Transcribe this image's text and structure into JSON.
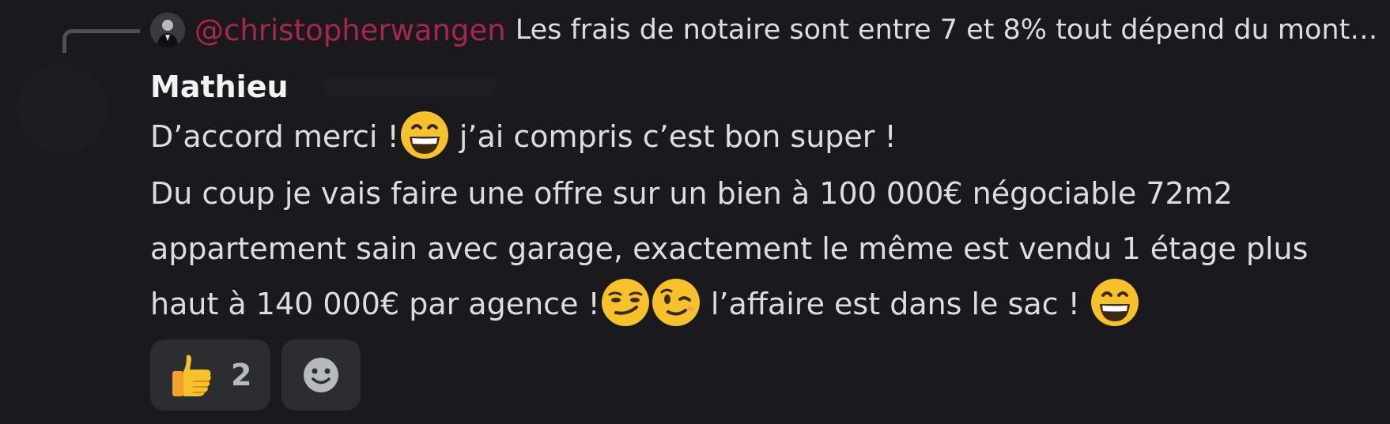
{
  "reply": {
    "author": "@christopherwangen",
    "text": "Les frais de notaire sont entre 7 et 8% tout dépend du monta..."
  },
  "message": {
    "author": "Mathieu",
    "line1_part1": "D’accord merci !",
    "line1_emoji": "grinning-face-icon",
    "line1_part2": " j’ai compris c’est bon super !",
    "para2_line1": "Du coup je vais faire une offre sur un bien à 100 000€ négociable 72m2",
    "para2_line2": "appartement sain avec garage, exactement le même est vendu 1 étage plus",
    "para2_line3_part1": "haut à 140 000€ par agence !",
    "para2_line3_emojis": [
      "smirking-face-icon",
      "winking-face-icon"
    ],
    "para2_line3_part2": " l’affaire est dans le sac ! ",
    "para2_line3_end_emoji": "grinning-face-icon"
  },
  "reactions": [
    {
      "emoji": "thumbs-up-icon",
      "count": "2"
    }
  ],
  "add_reaction_icon": "smiley-icon",
  "colors": {
    "background": "#1a1a1e",
    "reply_author": "#a8254f",
    "text": "#dbdee1",
    "author": "#f2f3f5",
    "reaction_bg": "#2b2d31",
    "emoji_yellow": "#f7c12c"
  }
}
